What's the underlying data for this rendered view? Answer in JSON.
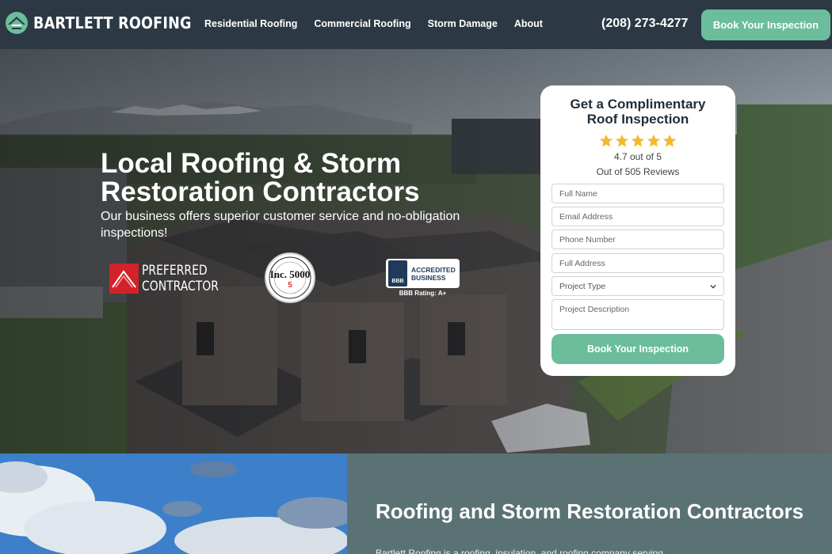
{
  "nav": {
    "brand": "BARTLETT ROOFING",
    "links": [
      "Residential Roofing",
      "Commercial Roofing",
      "Storm Damage",
      "About"
    ],
    "phone": "(208) 273-4277",
    "cta": "Book Your Inspection"
  },
  "hero": {
    "title": "Local Roofing & Storm Restoration Contractors",
    "subtitle": "Our business offers superior customer service and no-obligation inspections!",
    "badges": {
      "owens": "PREFERRED CONTRACTOR",
      "inc": "Inc. 5000",
      "bbb_label": "ACCREDITED BUSINESS",
      "bbb_logo": "BBB",
      "bbb_rating": "BBB Rating: A+"
    }
  },
  "form": {
    "title": "Get a Complimentary Roof Inspection",
    "star_count": 5,
    "rating": "4.7 out of 5",
    "reviews": "Out of 505 Reviews",
    "full_name": "Full Name",
    "email": "Email Address",
    "phone": "Phone Number",
    "address": "Full Address",
    "project_type": "Project Type",
    "description": "Project Description",
    "submit": "Book Your Inspection"
  },
  "lower": {
    "title": "Roofing and Storm Restoration Contractors",
    "body": "Bartlett Roofing is a roofing, insulation, and roofing company serving"
  },
  "colors": {
    "accent": "#6cbd9b",
    "nav_bg": "#2c3944",
    "panel": "#5b7275",
    "star": "#f5b82e"
  }
}
